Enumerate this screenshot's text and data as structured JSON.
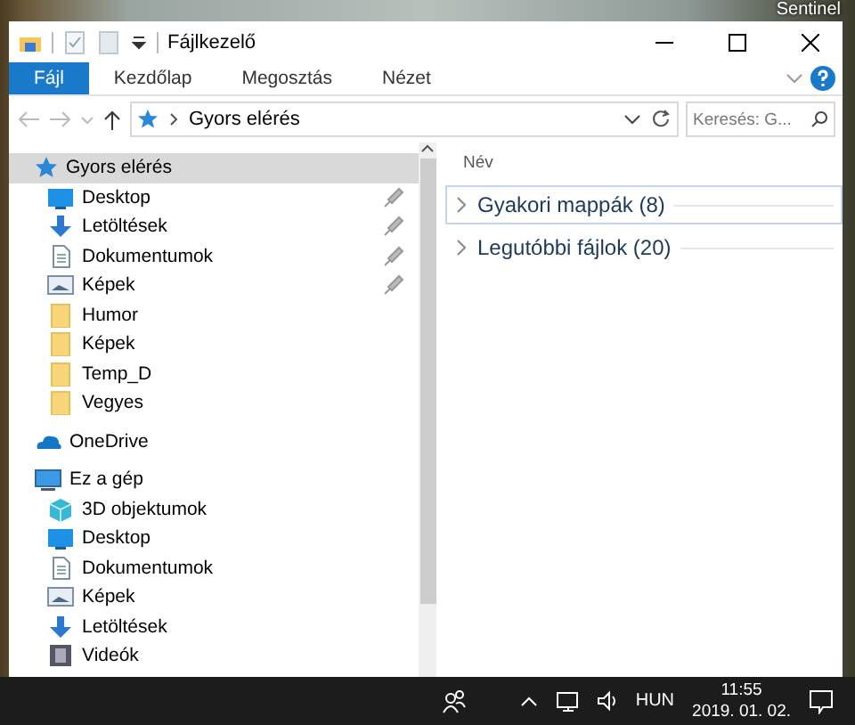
{
  "desktop": {
    "icon_label": "Sentinel"
  },
  "window": {
    "title": "Fájlkezelő"
  },
  "ribbon_tabs": [
    {
      "label": "Fájl",
      "selected": true
    },
    {
      "label": "Kezdőlap",
      "selected": false
    },
    {
      "label": "Megosztás",
      "selected": false
    },
    {
      "label": "Nézet",
      "selected": false
    }
  ],
  "address_bar": {
    "path": "Gyors elérés"
  },
  "search": {
    "placeholder": "Keresés: G..."
  },
  "navigation": [
    {
      "label": "Gyors elérés",
      "kind": "star",
      "selected": true,
      "children": [
        {
          "label": "Desktop",
          "kind": "desktop",
          "selected": false,
          "pinned": true
        },
        {
          "label": "Letöltések",
          "kind": "download",
          "selected": false,
          "pinned": true
        },
        {
          "label": "Dokumentumok",
          "kind": "document",
          "selected": false,
          "pinned": true
        },
        {
          "label": "Képek",
          "kind": "pictures",
          "selected": false,
          "pinned": true
        },
        {
          "label": "Humor",
          "kind": "folder",
          "selected": false,
          "pinned": false
        },
        {
          "label": "Képek",
          "kind": "folder",
          "selected": false,
          "pinned": false
        },
        {
          "label": "Temp_D",
          "kind": "folder",
          "selected": false,
          "pinned": false
        },
        {
          "label": "Vegyes",
          "kind": "folder",
          "selected": false,
          "pinned": false
        }
      ]
    },
    {
      "label": "OneDrive",
      "kind": "cloud",
      "selected": false
    },
    {
      "label": "Ez a gép",
      "kind": "pc",
      "selected": false,
      "children": [
        {
          "label": "3D objektumok",
          "kind": "cube",
          "selected": false,
          "pinned": false
        },
        {
          "label": "Desktop",
          "kind": "desktop",
          "selected": false,
          "pinned": false
        },
        {
          "label": "Dokumentumok",
          "kind": "document",
          "selected": false,
          "pinned": false
        },
        {
          "label": "Képek",
          "kind": "pictures",
          "selected": false,
          "pinned": false
        },
        {
          "label": "Letöltések",
          "kind": "download",
          "selected": false,
          "pinned": false
        },
        {
          "label": "Videók",
          "kind": "video",
          "selected": false,
          "pinned": false
        }
      ]
    }
  ],
  "content": {
    "column": "Név",
    "groups": [
      {
        "label": "Gyakori mappák (8)",
        "selected": true
      },
      {
        "label": "Legutóbbi fájlok (20)",
        "selected": false
      }
    ]
  },
  "taskbar": {
    "language": "HUN",
    "time": "11:55",
    "date": "2019. 01. 02."
  }
}
